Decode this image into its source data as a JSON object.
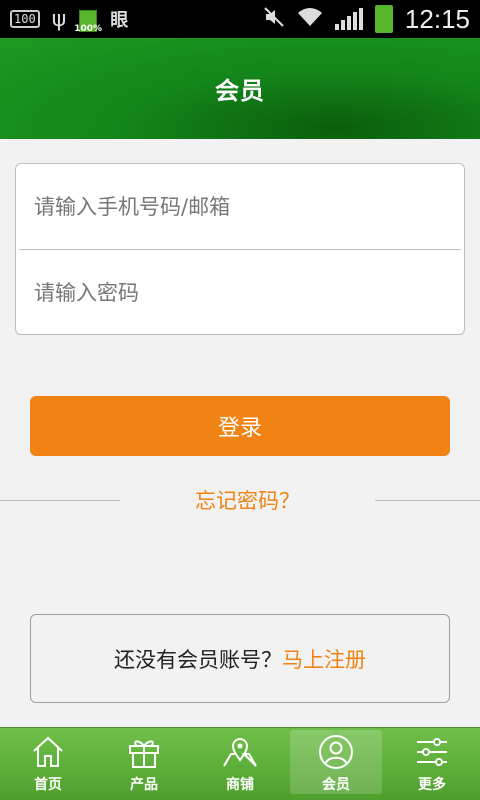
{
  "status_bar": {
    "badge": "100",
    "battery_small_pct": "100%",
    "doc_glyph": "眼",
    "time": "12:15"
  },
  "header": {
    "title": "会员"
  },
  "login_form": {
    "account_placeholder": "请输入手机号码/邮箱",
    "password_placeholder": "请输入密码",
    "login_label": "登录",
    "forgot_label": "忘记密码？"
  },
  "register": {
    "prompt": "还没有会员账号？",
    "link": "马上注册"
  },
  "bottom_nav": {
    "items": [
      {
        "label": "首页",
        "icon": "home-icon"
      },
      {
        "label": "产品",
        "icon": "gift-icon"
      },
      {
        "label": "商铺",
        "icon": "map-icon"
      },
      {
        "label": "会员",
        "icon": "user-icon",
        "active": true
      },
      {
        "label": "更多",
        "icon": "settings-sliders-icon"
      }
    ]
  },
  "colors": {
    "accent": "#f08313",
    "header_green": "#13851a",
    "nav_green": "#5aae38"
  }
}
